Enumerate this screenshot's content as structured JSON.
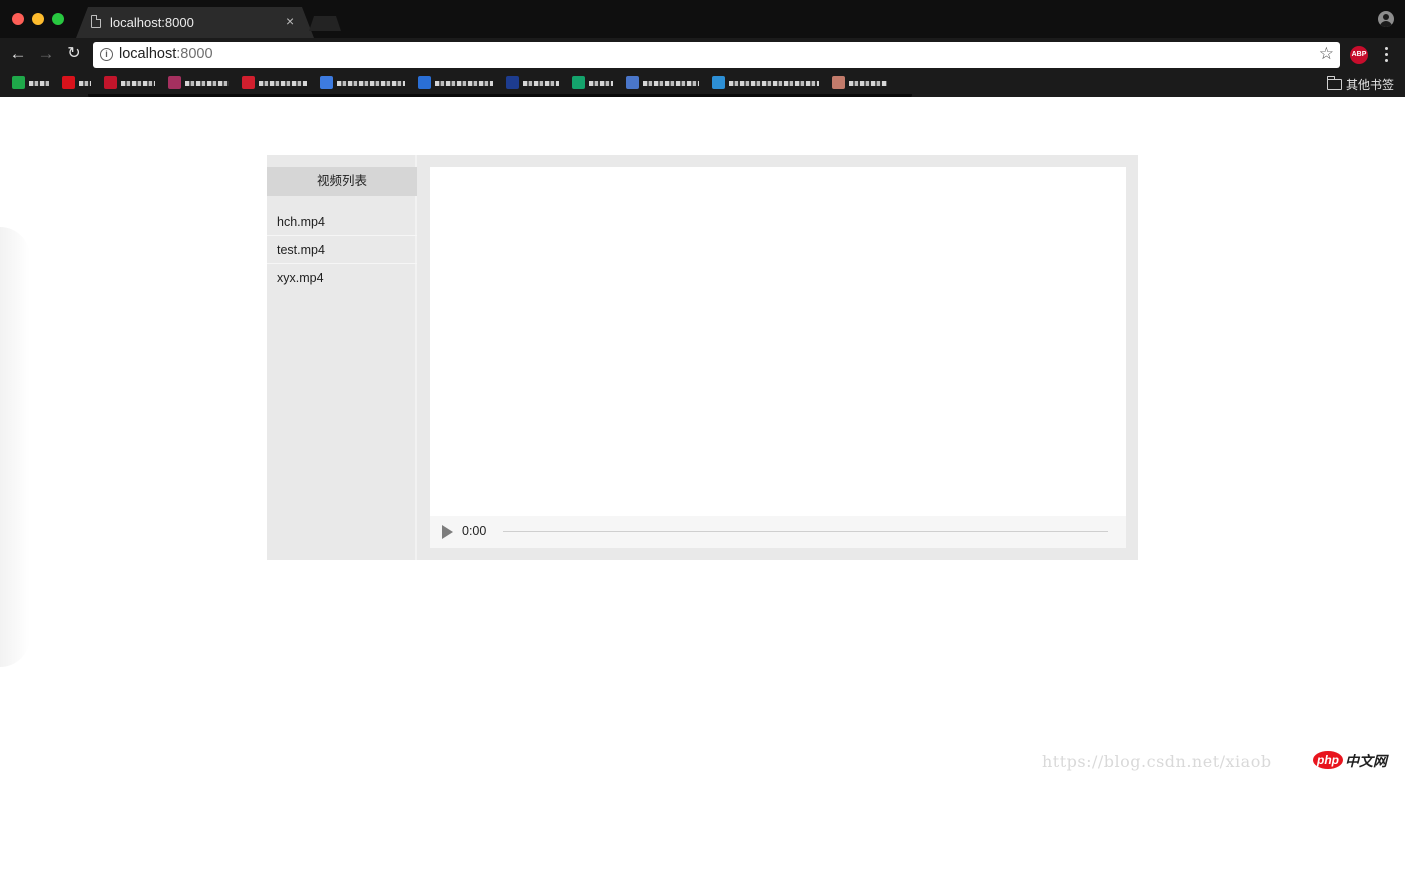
{
  "browser": {
    "tab_title": "localhost:8000",
    "tab_close": "×",
    "url_host": "localhost",
    "url_port": ":8000",
    "nav": {
      "back": "←",
      "forward": "→",
      "reload": "↻"
    },
    "star": "☆",
    "abp_label": "ABP",
    "other_bookmarks": "其他书签",
    "bookmark_colors": [
      "#1fa84a",
      "#d8121b",
      "#c2152b",
      "#a5305f",
      "#d11f2e",
      "#3d7be0",
      "#2a6fd6",
      "#1d3c8f",
      "#14a36c",
      "#4a76c9",
      "#2d8fd5",
      "#c27b6b"
    ]
  },
  "app": {
    "sidebar_title": "视频列表",
    "videos": [
      "hch.mp4",
      "test.mp4",
      "xyx.mp4"
    ],
    "player": {
      "time": "0:00"
    }
  },
  "watermark": {
    "text": "https://blog.csdn.net/xiaob",
    "logo_badge": "php",
    "logo_text": "中文网"
  }
}
